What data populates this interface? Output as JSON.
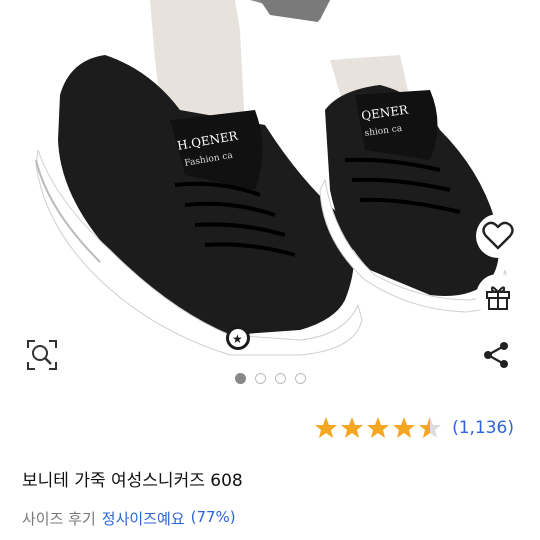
{
  "product": {
    "title": "보니테 가죽 여성스니커즈 608",
    "image_dots_total": 4,
    "image_dots_active": 1,
    "shoe_brand_text": "H.QENER",
    "shoe_sub_text": "Fashion ca"
  },
  "rating": {
    "stars": 4.5,
    "count_label": "(1,136)"
  },
  "size_review": {
    "label": "사이즈 후기",
    "verdict": "정사이즈예요",
    "percent": "(77%)"
  },
  "actions": {
    "wishlist_icon": "heart-icon",
    "gift_icon": "gift-icon",
    "zoom_icon": "zoom-search-icon",
    "share_icon": "share-icon"
  },
  "colors": {
    "link_blue": "#2e64d8",
    "star_gold": "#f5a623",
    "star_empty": "#dcdcdc"
  }
}
